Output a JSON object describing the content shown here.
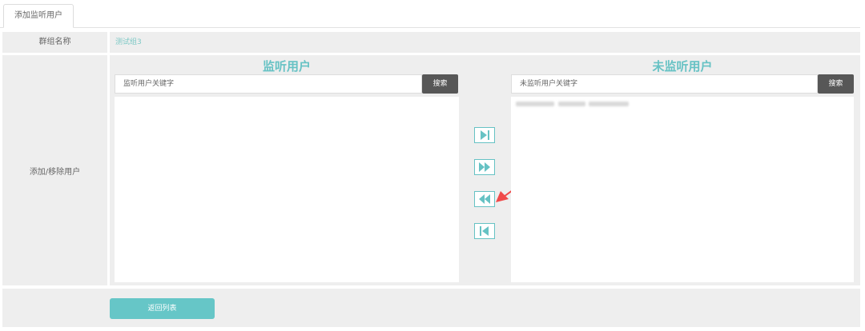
{
  "tab": {
    "label": "添加监听用户"
  },
  "form": {
    "group_name_label": "群组名称",
    "group_name_value": "测试组3",
    "users_label": "添加/移除用户"
  },
  "monitored": {
    "title": "监听用户",
    "search_placeholder": "监听用户关键字",
    "search_button": "搜索"
  },
  "unmonitored": {
    "title": "未监听用户",
    "search_placeholder": "未监听用户关键字",
    "search_button": "搜索"
  },
  "transfer_buttons": [
    {
      "icon": "move-selected-right-icon"
    },
    {
      "icon": "move-all-right-icon"
    },
    {
      "icon": "move-all-left-icon"
    },
    {
      "icon": "move-selected-left-icon"
    }
  ],
  "footer": {
    "back_button": "返回列表"
  },
  "colors": {
    "accent": "#66c2c4",
    "dark_button": "#575757",
    "panel_bg": "#eeeeee",
    "annotation": "#f04a4a"
  }
}
